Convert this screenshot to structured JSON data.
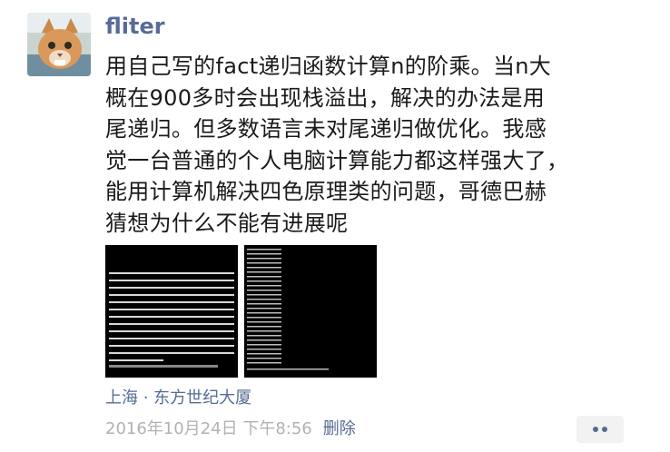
{
  "post": {
    "username": "fliter",
    "text_lines": [
      "用自己写的fact递归函数计算n的阶乘。当n大",
      "概在900多时会出现栈溢出，解决的办法是用",
      "尾递归。但多数语言未对尾递归做优化。我感",
      "觉一台普通的个人电脑计算能力都这样强大了，",
      "能用计算机解决四色原理类的问题，哥德巴赫",
      "猜想为什么不能有进展呢"
    ],
    "location": "上海 · 东方世纪大厦",
    "timestamp": "2016年10月24日 下午8:56",
    "delete_label": "删除"
  },
  "icons": {
    "avatar": "cat-avatar",
    "more": "more-dots-icon"
  },
  "colors": {
    "link": "#576b95",
    "meta": "#b2b2b2",
    "text": "#1a1a1a"
  }
}
